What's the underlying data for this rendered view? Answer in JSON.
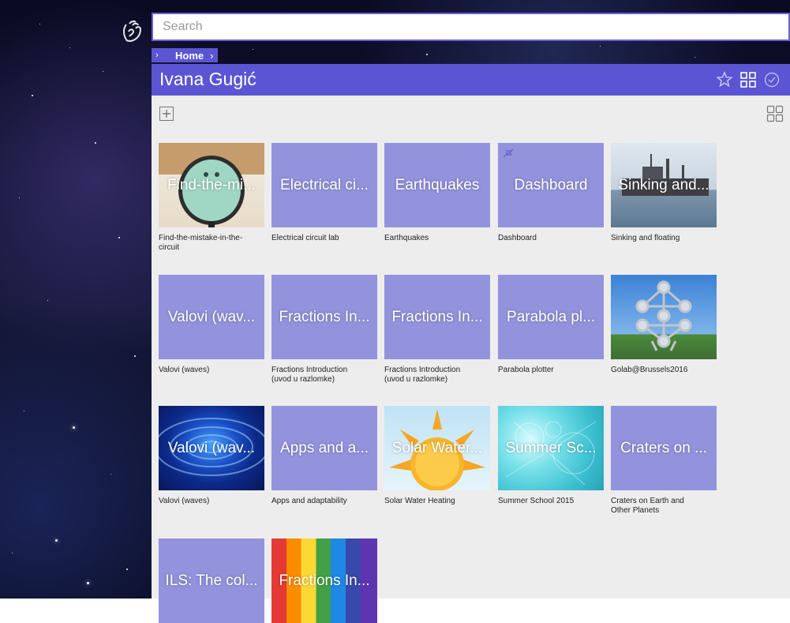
{
  "search": {
    "placeholder": "Search"
  },
  "breadcrumb": {
    "home": "Home"
  },
  "header": {
    "title": "Ivana Gugić"
  },
  "tiles": [
    {
      "label": "Find-the-mi...",
      "caption": "Find-the-mistake-in-the-circuit"
    },
    {
      "label": "Electrical ci...",
      "caption": "Electrical circuit lab"
    },
    {
      "label": "Earthquakes",
      "caption": "Earthquakes"
    },
    {
      "label": "Dashboard",
      "caption": "Dashboard"
    },
    {
      "label": "Sinking and...",
      "caption": "Sinking and floating"
    },
    {
      "label": "Valovi (wav...",
      "caption": "Valovi (waves)"
    },
    {
      "label": "Fractions In...",
      "caption": "Fractions Introduction (uvod u razlomke)"
    },
    {
      "label": "Fractions In...",
      "caption": "Fractions Introduction (uvod u razlomke)"
    },
    {
      "label": "Parabola pl...",
      "caption": "Parabola plotter"
    },
    {
      "label": "",
      "caption": "Golab@Brussels2016"
    },
    {
      "label": "Valovi (wav...",
      "caption": "Valovi (waves)"
    },
    {
      "label": "Apps and a...",
      "caption": "Apps and adaptability"
    },
    {
      "label": "Solar Water...",
      "caption": "Solar Water Heating"
    },
    {
      "label": "Summer Sc...",
      "caption": "Summer School 2015"
    },
    {
      "label": "Craters on ...",
      "caption": "Craters on Earth and Other Planets"
    },
    {
      "label": "ILS: The col...",
      "caption": ""
    },
    {
      "label": "Fractions In...",
      "caption": ""
    }
  ],
  "colors": {
    "accent": "#5b55d3",
    "tile": "#9393dd",
    "background": "#ededed"
  },
  "icons": [
    "hand-logo-icon",
    "star-icon",
    "grid-icon",
    "clock-icon",
    "add-icon",
    "unpin-icon"
  ]
}
